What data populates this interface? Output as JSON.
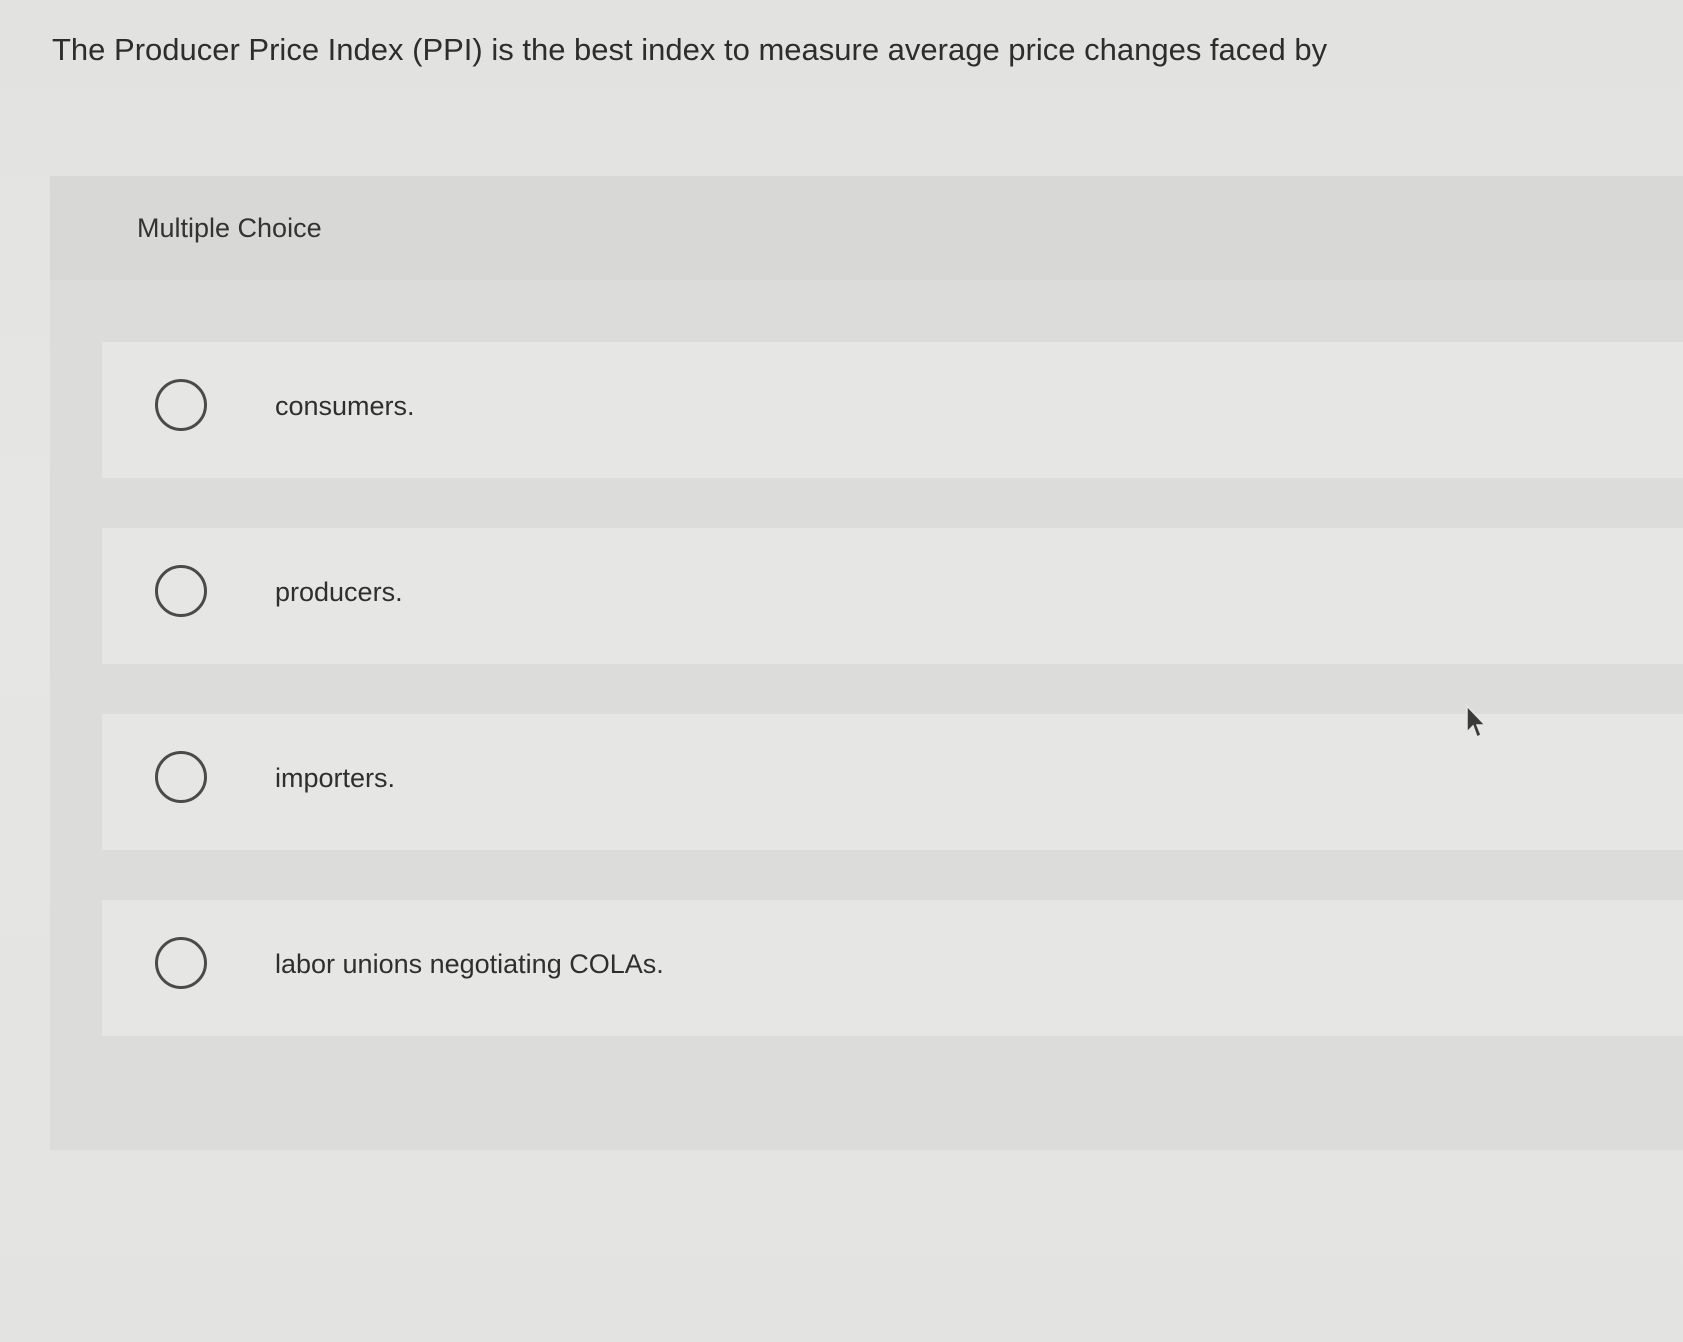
{
  "question": {
    "text": "The Producer Price Index (PPI) is the best index to measure average price changes faced by"
  },
  "multiple_choice": {
    "title": "Multiple Choice",
    "options": [
      {
        "label": "consumers.",
        "selected": false
      },
      {
        "label": "producers.",
        "selected": false
      },
      {
        "label": "importers.",
        "selected": false
      },
      {
        "label": "labor unions negotiating COLAs.",
        "selected": false
      }
    ]
  },
  "cursor": {
    "icon": "mouse-pointer-icon"
  },
  "colors": {
    "background": "#e4e4e2",
    "panel": "#dcdcda",
    "option_row": "#e6e6e4",
    "text": "#2d2d2d",
    "radio_border": "#4a4a4a"
  }
}
